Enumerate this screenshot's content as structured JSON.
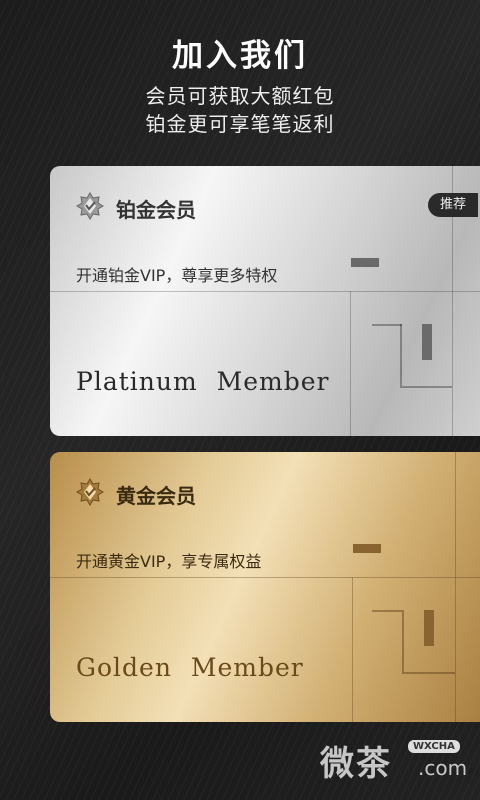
{
  "header": {
    "title": "加入我们",
    "subtitle1": "会员可获取大额红包",
    "subtitle2": "铂金更可享笔笔返利"
  },
  "cards": [
    {
      "name": "铂金会员",
      "description": "开通铂金VIP，尊享更多特权",
      "english": "Platinum  Member",
      "badge": "推荐",
      "accent": "#c8c8c8"
    },
    {
      "name": "黄金会员",
      "description": "开通黄金VIP，享专属权益",
      "english": "Golden  Member",
      "accent": "#d2b074"
    }
  ],
  "watermark": {
    "main": "微茶",
    "tag": "WXCHA",
    "domain": ".com"
  }
}
